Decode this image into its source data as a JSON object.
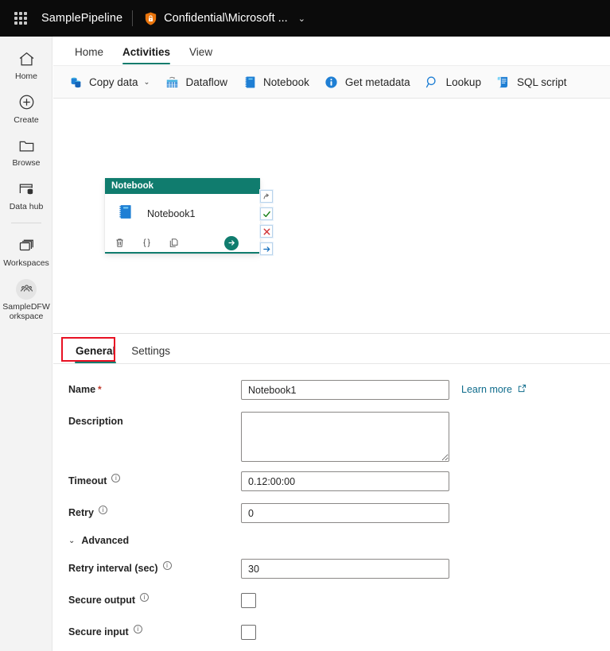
{
  "topbar": {
    "waffle_icon": "app-launcher-waffle-icon",
    "pipeline_name": "SamplePipeline",
    "sensitivity_icon": "shield-lock-icon",
    "sensitivity_label": "Confidential\\Microsoft ...",
    "chevron": "⌄"
  },
  "rail": {
    "items": [
      {
        "label": "Home",
        "icon": "home-icon"
      },
      {
        "label": "Create",
        "icon": "plus-circle-icon"
      },
      {
        "label": "Browse",
        "icon": "folder-icon"
      },
      {
        "label": "Data hub",
        "icon": "data-hub-icon"
      },
      {
        "label": "Workspaces",
        "icon": "workspaces-icon"
      },
      {
        "label": "SampleDFWorkspace",
        "icon": "people-group-icon"
      }
    ]
  },
  "ribbon": {
    "tabs": [
      {
        "label": "Home",
        "active": false
      },
      {
        "label": "Activities",
        "active": true
      },
      {
        "label": "View",
        "active": false
      }
    ],
    "buttons": [
      {
        "label": "Copy data",
        "icon": "copy-data-icon",
        "chevron": "⌄"
      },
      {
        "label": "Dataflow",
        "icon": "dataflow-icon",
        "chevron": ""
      },
      {
        "label": "Notebook",
        "icon": "notebook-icon",
        "chevron": ""
      },
      {
        "label": "Get metadata",
        "icon": "info-circle-icon",
        "chevron": ""
      },
      {
        "label": "Lookup",
        "icon": "magnifier-icon",
        "chevron": ""
      },
      {
        "label": "SQL script",
        "icon": "sql-script-icon",
        "chevron": ""
      }
    ]
  },
  "canvas": {
    "node": {
      "header": "Notebook",
      "title": "Notebook1",
      "header_color": "#107c6e",
      "footer_icons": [
        {
          "name": "delete-icon",
          "glyph": "🗑"
        },
        {
          "name": "code-braces-icon",
          "glyph": "{ }"
        },
        {
          "name": "duplicate-icon",
          "glyph": "❐"
        }
      ],
      "run_icon": "run-arrow-icon"
    },
    "chips": [
      {
        "name": "on-skip-icon",
        "color": "#7a7a7a"
      },
      {
        "name": "on-success-icon",
        "color": "#107c10"
      },
      {
        "name": "on-failure-icon",
        "color": "#d13438"
      },
      {
        "name": "on-completion-icon",
        "color": "#0f6cbd"
      }
    ]
  },
  "properties": {
    "tabs": [
      {
        "label": "General",
        "active": true,
        "highlighted": true
      },
      {
        "label": "Settings",
        "active": false,
        "highlighted": false
      }
    ],
    "fields": {
      "name": {
        "label": "Name",
        "required": "*",
        "value": "Notebook1",
        "placeholder": ""
      },
      "learn_more": {
        "label": "Learn more",
        "icon": "external-link-icon"
      },
      "description": {
        "label": "Description",
        "value": "",
        "placeholder": ""
      },
      "timeout": {
        "label": "Timeout",
        "info": "i",
        "value": "0.12:00:00",
        "placeholder": ""
      },
      "retry": {
        "label": "Retry",
        "info": "i",
        "value": "0",
        "placeholder": ""
      },
      "advanced": {
        "label": "Advanced",
        "chevron": "⌄",
        "expanded": true
      },
      "retry_interval": {
        "label": "Retry interval (sec)",
        "info": "i",
        "value": "30",
        "placeholder": ""
      },
      "secure_output": {
        "label": "Secure output",
        "info": "i",
        "checked": false
      },
      "secure_input": {
        "label": "Secure input",
        "info": "i",
        "checked": false
      }
    }
  },
  "colors": {
    "accent_teal": "#107c6e",
    "topbar_black": "#0b0b0b",
    "rail_bg": "#f3f3f3",
    "highlight_red": "#e81123",
    "link_blue": "#0f6c8c"
  }
}
